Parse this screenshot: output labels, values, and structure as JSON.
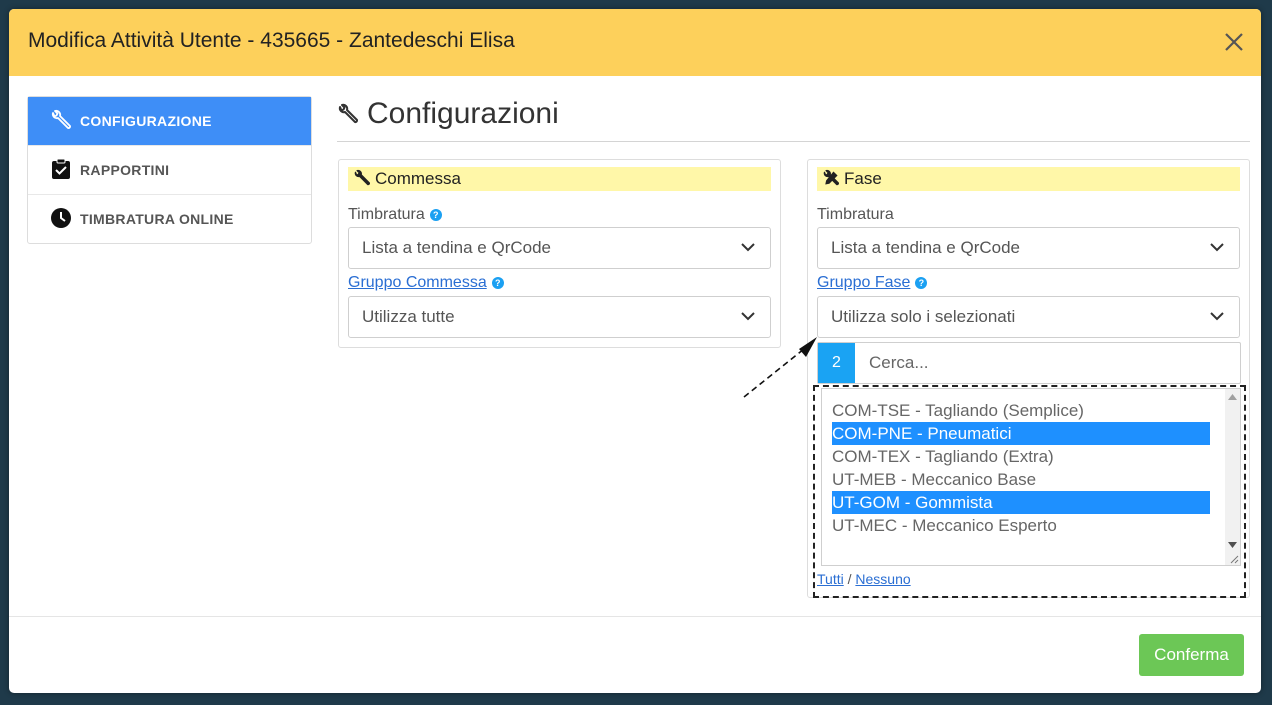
{
  "modal": {
    "title": "Modifica Attività Utente - 435665 - Zantedeschi Elisa"
  },
  "sidebar": {
    "items": [
      {
        "label": "CONFIGURAZIONE",
        "icon": "wrench-icon",
        "active": true
      },
      {
        "label": "RAPPORTINI",
        "icon": "clipboard-check-icon",
        "active": false
      },
      {
        "label": "TIMBRATURA ONLINE",
        "icon": "clock-icon",
        "active": false
      }
    ]
  },
  "main": {
    "title": "Configurazioni",
    "commessa": {
      "heading": "Commessa",
      "timbratura_label": "Timbratura",
      "timbratura_value": "Lista a tendina e QrCode",
      "gruppo_label": "Gruppo Commessa",
      "gruppo_value": "Utilizza tutte"
    },
    "fase": {
      "heading": "Fase",
      "timbratura_label": "Timbratura",
      "timbratura_value": "Lista a tendina e QrCode",
      "gruppo_label": "Gruppo Fase",
      "gruppo_value": "Utilizza solo i selezionati",
      "selected_count": "2",
      "search_placeholder": "Cerca...",
      "options": [
        {
          "label": "COM-TSE - Tagliando (Semplice)",
          "selected": false
        },
        {
          "label": "COM-PNE - Pneumatici",
          "selected": true
        },
        {
          "label": "COM-TEX - Tagliando (Extra)",
          "selected": false
        },
        {
          "label": "UT-MEB - Meccanico Base",
          "selected": false
        },
        {
          "label": "UT-GOM - Gommista",
          "selected": true
        },
        {
          "label": "UT-MEC - Meccanico Esperto",
          "selected": false
        }
      ],
      "link_all": "Tutti",
      "link_sep": "/",
      "link_none": "Nessuno"
    }
  },
  "footer": {
    "confirm_label": "Conferma"
  },
  "colors": {
    "header_bg": "#fdd05b",
    "active_nav": "#3e8ef7",
    "panel_head_bg": "#fff7a8",
    "selected_option": "#1e90ff",
    "badge": "#1aa3f3",
    "confirm": "#6cc756"
  }
}
